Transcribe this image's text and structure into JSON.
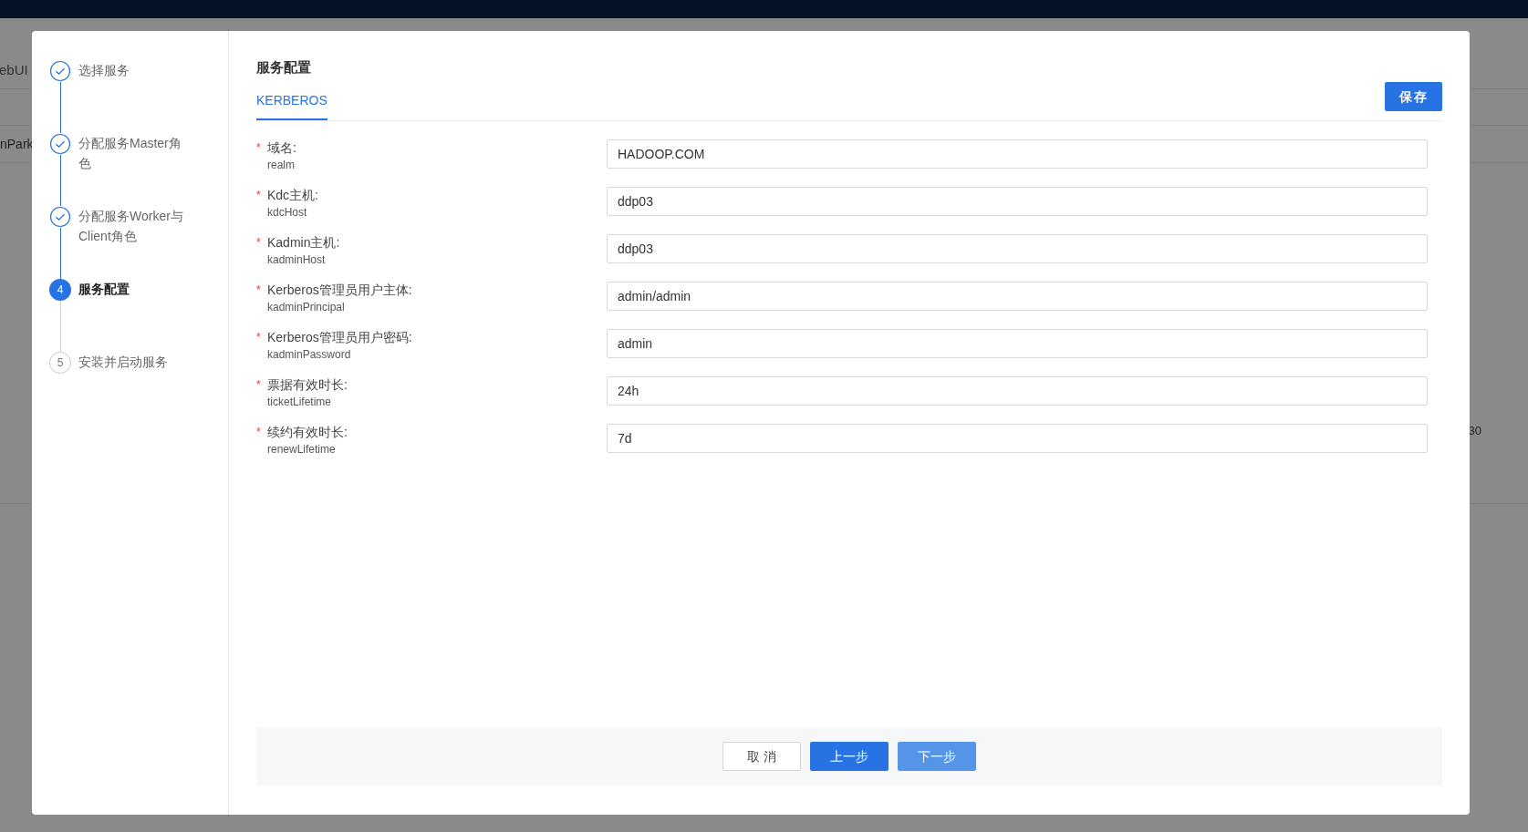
{
  "background": {
    "texts": [
      {
        "kind": "link",
        "text": "ebUI"
      },
      {
        "kind": "tab",
        "text": "nPark"
      },
      {
        "kind": "cell",
        "text": "30"
      }
    ]
  },
  "steps": [
    {
      "label": "选择服务",
      "completed": true,
      "selected": false
    },
    {
      "label": "分配服务Master角色",
      "completed": true,
      "selected": false
    },
    {
      "label": "分配服务Worker与Client角色",
      "completed": true,
      "selected": false
    },
    {
      "label": "服务配置",
      "completed": false,
      "selected": true,
      "number": "4"
    },
    {
      "label": "安装并启动服务",
      "completed": false,
      "selected": false,
      "number": "5"
    }
  ],
  "title": "服务配置",
  "tabs": [
    {
      "label": "KERBEROS",
      "selected": true
    }
  ],
  "save_button": "保存",
  "fields": [
    {
      "required_mark": "*",
      "label": "域名:",
      "key": "realm",
      "value": "HADOOP.COM"
    },
    {
      "required_mark": "*",
      "label": "Kdc主机:",
      "key": "kdcHost",
      "value": "ddp03"
    },
    {
      "required_mark": "*",
      "label": "Kadmin主机:",
      "key": "kadminHost",
      "value": "ddp03"
    },
    {
      "required_mark": "*",
      "label": "Kerberos管理员用户主体:",
      "key": "kadminPrincipal",
      "value": "admin/admin"
    },
    {
      "required_mark": "*",
      "label": "Kerberos管理员用户密码:",
      "key": "kadminPassword",
      "value": "admin"
    },
    {
      "required_mark": "*",
      "label": "票据有效时长:",
      "key": "ticketLifetime",
      "value": "24h"
    },
    {
      "required_mark": "*",
      "label": "续约有效时长:",
      "key": "renewLifetime",
      "value": "7d"
    }
  ],
  "footer_buttons": [
    {
      "label": "取 消",
      "kind": "default"
    },
    {
      "label": "上一步",
      "kind": "primary"
    },
    {
      "label": "下一步",
      "kind": "primary-light"
    }
  ]
}
